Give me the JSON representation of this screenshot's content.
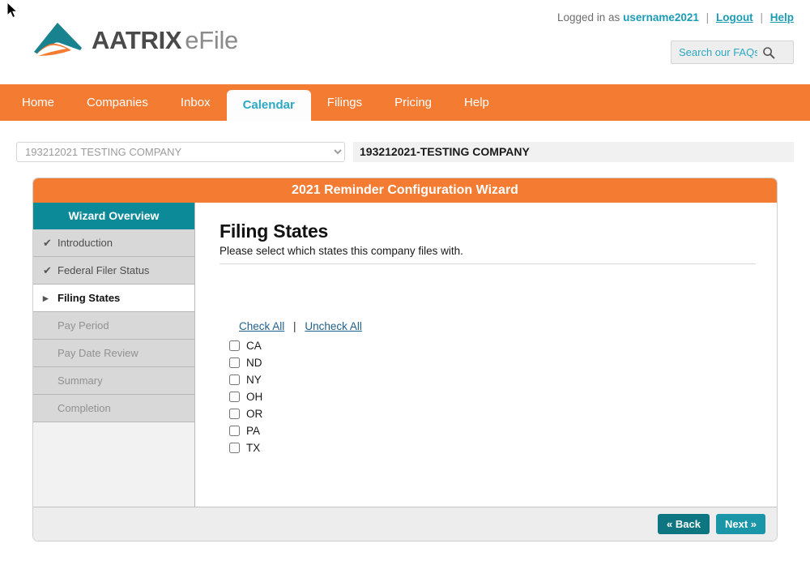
{
  "header": {
    "logo": {
      "icon": "aatrix-mountain-logo",
      "brand": "AATRIX",
      "product": "eFile",
      "teal": "#18828f",
      "orange": "#f47b32"
    },
    "login_prefix": "Logged in as",
    "username": "username2021",
    "logout_label": "Logout",
    "help_label": "Help",
    "separator": "|",
    "search": {
      "placeholder": "Search our FAQs",
      "value": "",
      "icon": "search-icon"
    }
  },
  "nav": {
    "items": [
      {
        "label": "Home",
        "active": false
      },
      {
        "label": "Companies",
        "active": false
      },
      {
        "label": "Inbox",
        "active": false
      },
      {
        "label": "Calendar",
        "active": true
      },
      {
        "label": "Filings",
        "active": false
      },
      {
        "label": "Pricing",
        "active": false
      },
      {
        "label": "Help",
        "active": false
      }
    ],
    "bar_color": "#f47b32",
    "active_text_color": "#2aa8c4"
  },
  "company_bar": {
    "select_value": "193212021 TESTING COMPANY",
    "company_name": "193212021-TESTING COMPANY"
  },
  "wizard": {
    "title": "2021 Reminder Configuration Wizard",
    "sidebar": {
      "heading": "Wizard Overview",
      "steps": [
        {
          "label": "Introduction",
          "state": "done",
          "bullet": "✔"
        },
        {
          "label": "Federal Filer Status",
          "state": "done",
          "bullet": "✔"
        },
        {
          "label": "Filing States",
          "state": "current",
          "bullet": "▸"
        },
        {
          "label": "Pay Period",
          "state": "pending",
          "bullet": ""
        },
        {
          "label": "Pay Date Review",
          "state": "pending",
          "bullet": ""
        },
        {
          "label": "Summary",
          "state": "pending",
          "bullet": ""
        },
        {
          "label": "Completion",
          "state": "pending",
          "bullet": ""
        }
      ]
    },
    "main": {
      "title": "Filing States",
      "subtitle": "Please select which states this company files with.",
      "check_all_label": "Check All",
      "uncheck_all_label": "Uncheck All",
      "separator": "|",
      "states": [
        {
          "code": "CA",
          "checked": false
        },
        {
          "code": "ND",
          "checked": false
        },
        {
          "code": "NY",
          "checked": false
        },
        {
          "code": "OH",
          "checked": false
        },
        {
          "code": "OR",
          "checked": false
        },
        {
          "code": "PA",
          "checked": false
        },
        {
          "code": "TX",
          "checked": false
        }
      ]
    },
    "footer": {
      "back_label": "« Back",
      "next_label": "Next »",
      "back_color": "#0d7680",
      "next_color": "#1a96a8"
    }
  }
}
